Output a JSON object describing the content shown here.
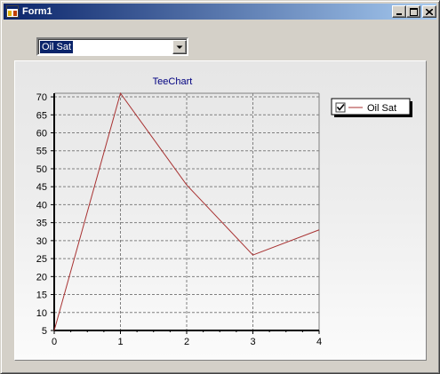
{
  "window": {
    "title": "Form1"
  },
  "combo": {
    "selected": "Oil Sat"
  },
  "chart_data": {
    "type": "line",
    "title": "TeeChart",
    "x": [
      0,
      1,
      2,
      3,
      4
    ],
    "series": [
      {
        "name": "Oil Sat",
        "values": [
          5,
          71,
          45.5,
          26,
          33
        ],
        "color": "#a83232"
      }
    ],
    "xlim": [
      0,
      4
    ],
    "ylim": [
      5,
      71
    ],
    "yticks": [
      5,
      10,
      15,
      20,
      25,
      30,
      35,
      40,
      45,
      50,
      55,
      60,
      65,
      70
    ],
    "xticks": [
      0,
      1,
      2,
      3,
      4
    ],
    "grid": true,
    "legend": {
      "position": "right",
      "checked": true
    },
    "colors": {
      "title": "#000080",
      "grid": "#808080"
    }
  }
}
